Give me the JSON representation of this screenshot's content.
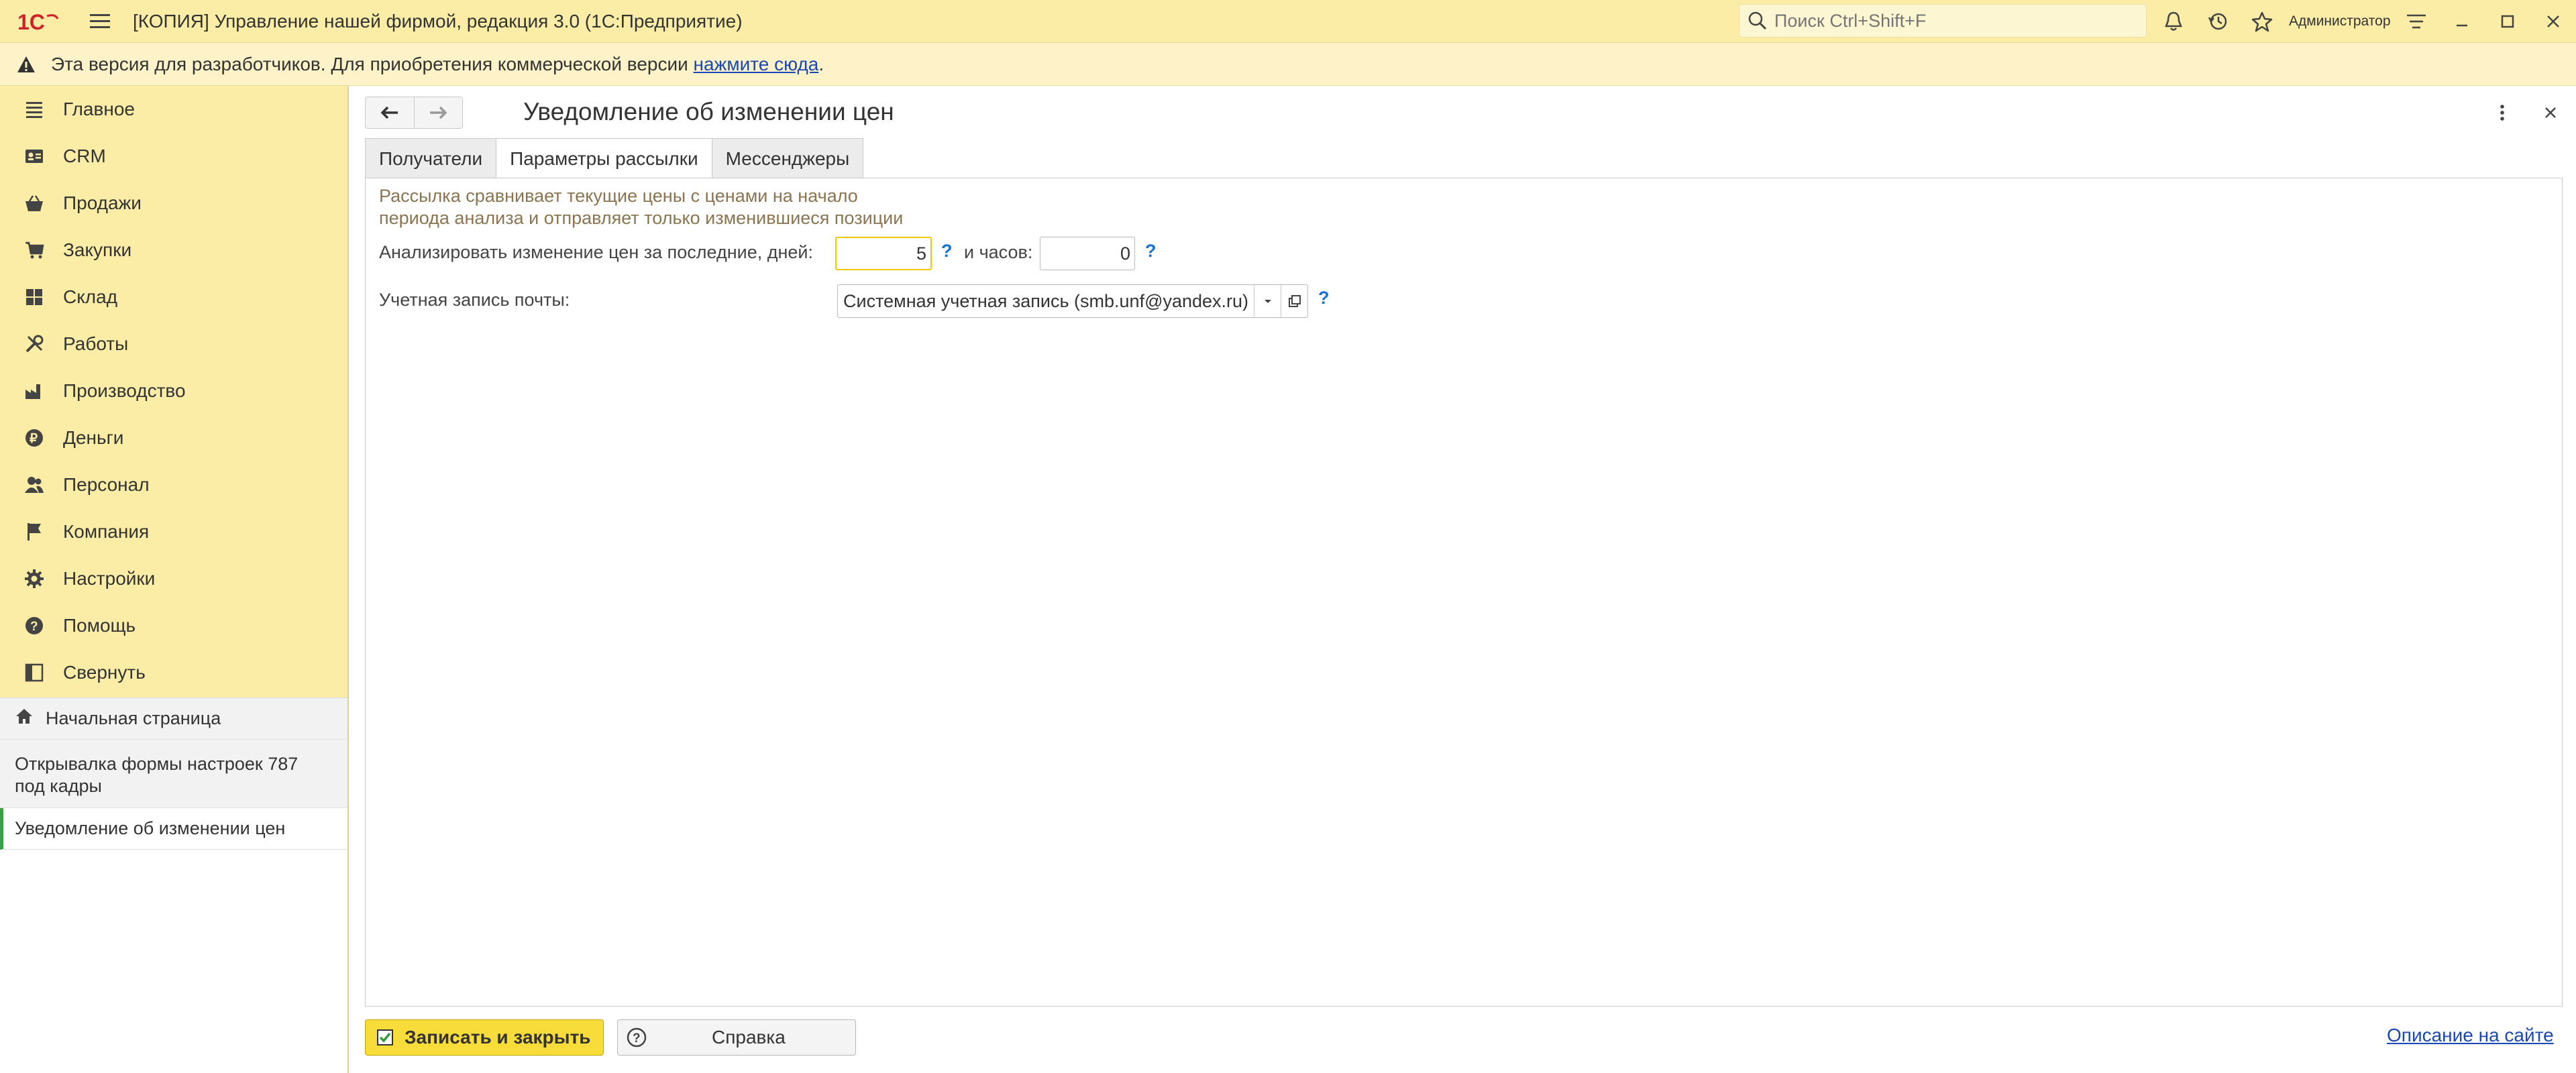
{
  "app": {
    "logo_text": "1С",
    "title": "[КОПИЯ] Управление нашей фирмой, редакция 3.0  (1С:Предприятие)",
    "search_placeholder": "Поиск Ctrl+Shift+F",
    "user": "Администратор"
  },
  "banner": {
    "text": "Эта версия для разработчиков. Для приобретения коммерческой версии ",
    "link": "нажмите сюда",
    "suffix": "."
  },
  "sidebar": {
    "items": [
      {
        "label": "Главное",
        "icon": "list-icon"
      },
      {
        "label": "CRM",
        "icon": "crm-icon"
      },
      {
        "label": "Продажи",
        "icon": "basket-icon"
      },
      {
        "label": "Закупки",
        "icon": "cart-icon"
      },
      {
        "label": "Склад",
        "icon": "warehouse-icon"
      },
      {
        "label": "Работы",
        "icon": "tools-icon"
      },
      {
        "label": "Производство",
        "icon": "factory-icon"
      },
      {
        "label": "Деньги",
        "icon": "ruble-icon"
      },
      {
        "label": "Персонал",
        "icon": "people-icon"
      },
      {
        "label": "Компания",
        "icon": "flag-icon"
      },
      {
        "label": "Настройки",
        "icon": "gear-icon"
      },
      {
        "label": "Помощь",
        "icon": "help-icon"
      },
      {
        "label": "Свернуть",
        "icon": "collapse-icon"
      }
    ],
    "open_windows": {
      "home": "Начальная страница",
      "settings_opener": "Открывалка формы настроек 787 под кадры",
      "current": "Уведомление об изменении цен"
    }
  },
  "form": {
    "title": "Уведомление об изменении цен",
    "tabs": [
      "Получатели",
      "Параметры рассылки",
      "Мессенджеры"
    ],
    "active_tab": "Параметры рассылки",
    "hint_line1": "Рассылка сравнивает текущие цены с ценами на начало",
    "hint_line2": "периода анализа и отправляет только изменившиеся позиции",
    "days_label": "Анализировать изменение цен за последние, дней:",
    "days_value": "5",
    "hours_label": "и часов:",
    "hours_value": "0",
    "question_mark": "?",
    "mail_label": "Учетная запись почты:",
    "mail_value": "Системная учетная запись (smb.unf@yandex.ru)"
  },
  "footer": {
    "save_label": "Записать и закрыть",
    "help_label": "Справка",
    "site_link": "Описание на сайте"
  },
  "colors": {
    "accent_yellow": "#fbeda6",
    "button_yellow": "#f8dc3a",
    "active_marker": "#3aa045",
    "link_blue": "#1a47b8",
    "hint_brown": "#8a7550"
  }
}
